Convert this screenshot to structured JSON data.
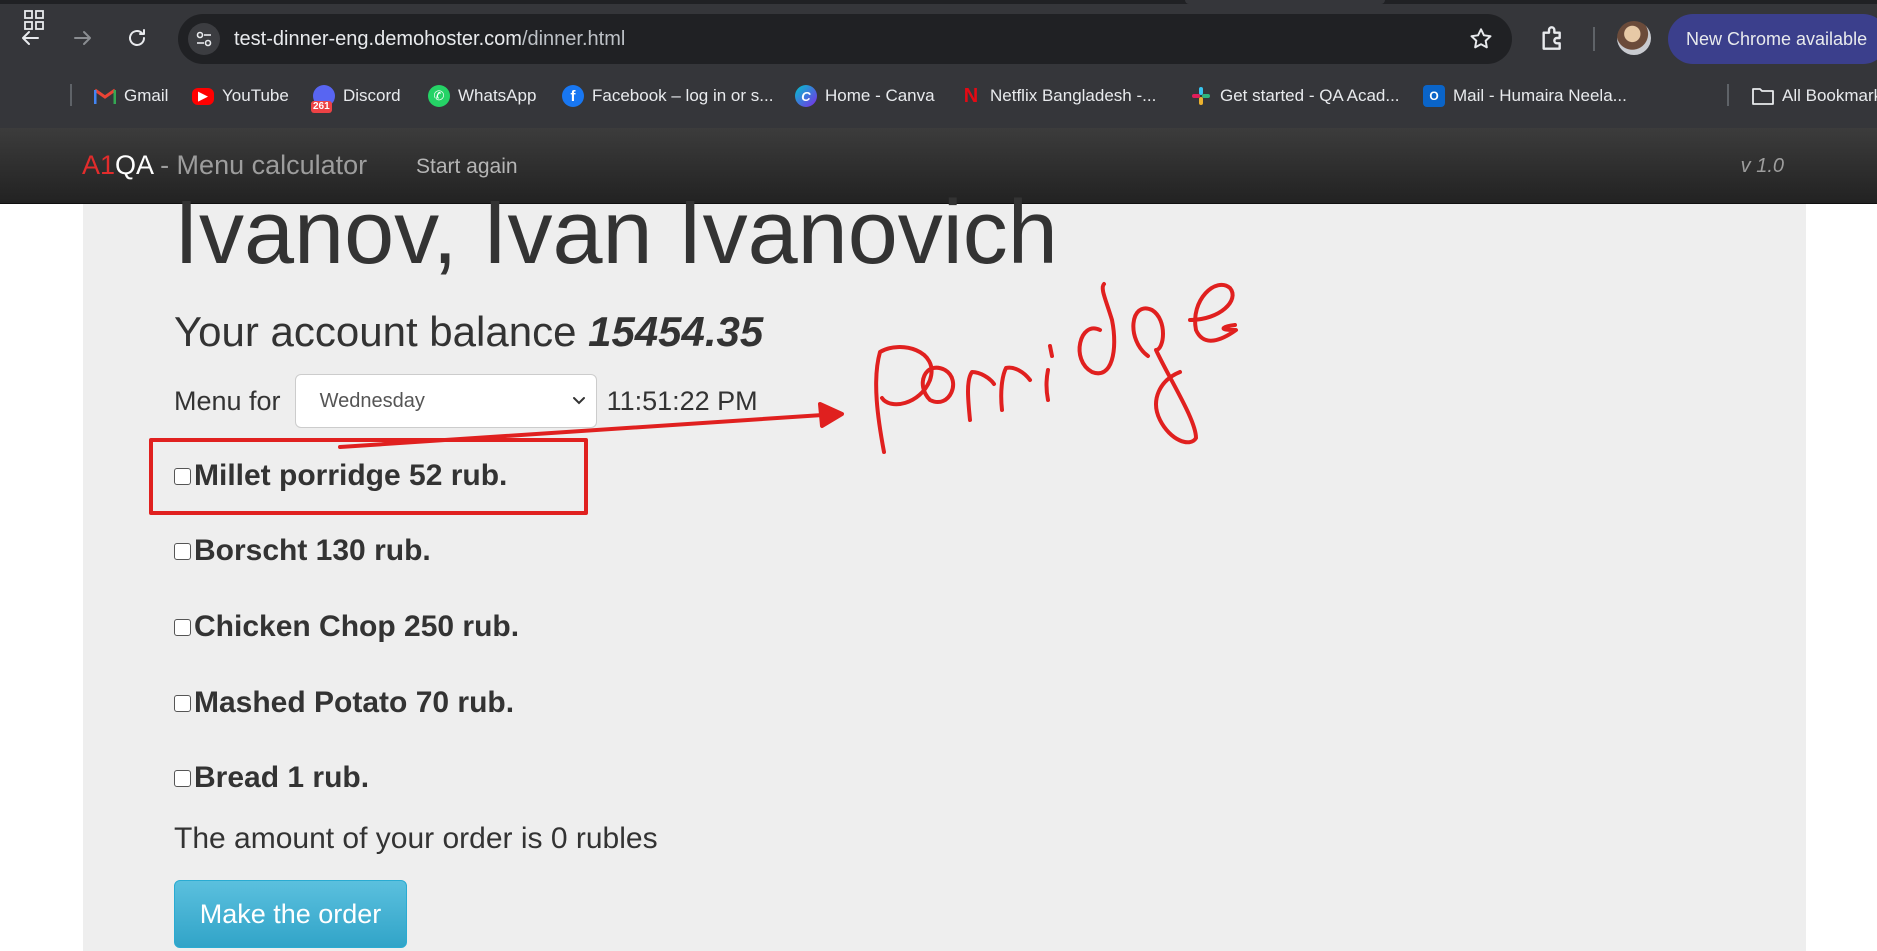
{
  "browser": {
    "url_host": "test-dinner-eng.demohoster.com",
    "url_path": "/dinner.html",
    "update_label": "New Chrome available",
    "bookmarks": [
      {
        "label": "Gmail",
        "icon": "gmail-icon"
      },
      {
        "label": "YouTube",
        "icon": "youtube-icon"
      },
      {
        "label": "Discord",
        "icon": "discord-icon",
        "badge": "261"
      },
      {
        "label": "WhatsApp",
        "icon": "whatsapp-icon"
      },
      {
        "label": "Facebook – log in or s...",
        "icon": "facebook-icon"
      },
      {
        "label": "Home - Canva",
        "icon": "canva-icon"
      },
      {
        "label": "Netflix Bangladesh -...",
        "icon": "netflix-icon"
      },
      {
        "label": "Get started - QA Acad...",
        "icon": "slack-icon"
      },
      {
        "label": "Mail - Humaira Neela...",
        "icon": "outlook-icon"
      },
      {
        "label": "All Bookmarks",
        "icon": "folder-icon"
      }
    ]
  },
  "navbar": {
    "brand_a1": "A1",
    "brand_qa": "QA",
    "brand_rest": " - Menu calculator",
    "start_again": "Start again",
    "version": "v 1.0"
  },
  "main": {
    "user_name": "Ivanov, Ivan Ivanovich",
    "balance_label": "Your account balance ",
    "balance_value": "15454.35",
    "menu_label": "Menu for",
    "selected_day": "Wednesday",
    "time": "11:51:22 PM",
    "items": [
      {
        "label": "Millet porridge 52 rub.",
        "checked": false
      },
      {
        "label": "Borscht 130 rub.",
        "checked": false
      },
      {
        "label": "Chicken Chop 250 rub.",
        "checked": false
      },
      {
        "label": "Mashed Potato 70 rub.",
        "checked": false
      },
      {
        "label": "Bread 1 rub.",
        "checked": false
      }
    ],
    "order_amount": "The amount of your order is 0 rubles",
    "order_button": "Make the order"
  },
  "annotation": {
    "handwritten_text": "Porridge",
    "color": "#e0201f"
  },
  "colors": {
    "brand_red": "#e22c2c",
    "button_info": "#5bc0de",
    "jumbotron_bg": "#eeeeee",
    "chrome_dark": "#35363a"
  }
}
